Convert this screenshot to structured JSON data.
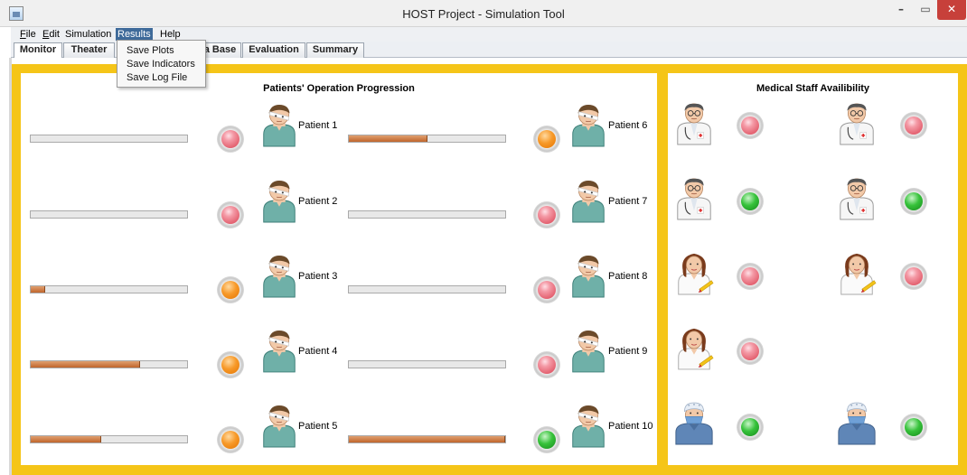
{
  "window": {
    "title": "HOST Project - Simulation Tool",
    "controls": {
      "minimize": "–",
      "maximize": "▭",
      "close": "✕"
    }
  },
  "menubar": {
    "items": [
      {
        "label": "File",
        "mnemonic": "F",
        "rest": "ile"
      },
      {
        "label": "Edit",
        "mnemonic": "E",
        "rest": "dit"
      },
      {
        "label": "Simulation",
        "mnemonic": "",
        "rest": "Simulation"
      },
      {
        "label": "Results",
        "mnemonic": "",
        "rest": "Results",
        "active": true
      },
      {
        "label": "Help",
        "mnemonic": "",
        "rest": "Help"
      }
    ]
  },
  "results_menu": {
    "items": [
      "Save Plots",
      "Save Indicators",
      "Save Log File"
    ]
  },
  "tabs": [
    {
      "label": "Monitor",
      "selected": true
    },
    {
      "label": "Theater"
    },
    {
      "label": "a Base"
    },
    {
      "label": "Evaluation"
    },
    {
      "label": "Summary"
    }
  ],
  "patients_panel": {
    "title": "Patients' Operation Progression",
    "patients": [
      {
        "label": "Patient 1",
        "progress": 0,
        "status": "red"
      },
      {
        "label": "Patient 2",
        "progress": 0,
        "status": "red"
      },
      {
        "label": "Patient 3",
        "progress": 0.09,
        "status": "orange"
      },
      {
        "label": "Patient 4",
        "progress": 0.7,
        "status": "orange"
      },
      {
        "label": "Patient 5",
        "progress": 0.45,
        "status": "orange"
      },
      {
        "label": "Patient 6",
        "progress": 0.5,
        "status": "orange"
      },
      {
        "label": "Patient 7",
        "progress": 0,
        "status": "red"
      },
      {
        "label": "Patient 8",
        "progress": 0,
        "status": "red"
      },
      {
        "label": "Patient 9",
        "progress": 0,
        "status": "red"
      },
      {
        "label": "Patient 10",
        "progress": 1.0,
        "status": "green"
      }
    ]
  },
  "staff_panel": {
    "title": "Medical Staff Availibility",
    "staff": [
      {
        "role": "doctor-male-icon",
        "status": "red"
      },
      {
        "role": "doctor-male-icon",
        "status": "red"
      },
      {
        "role": "doctor-male-icon",
        "status": "green"
      },
      {
        "role": "doctor-male-icon",
        "status": "green"
      },
      {
        "role": "nurse-female-icon",
        "status": "red"
      },
      {
        "role": "nurse-female-icon",
        "status": "red"
      },
      {
        "role": "nurse-female-icon",
        "status": "red"
      },
      {
        "role": "surgeon-masked-icon",
        "status": "green"
      },
      {
        "role": "surgeon-masked-icon",
        "status": "green"
      }
    ]
  },
  "colors": {
    "panel_border": "#f5c518",
    "progress_fill": "#c0652c",
    "led_red": "#e3606f",
    "led_orange": "#f79a2a",
    "led_green": "#36c23a",
    "menu_active": "#3e6a9a"
  }
}
